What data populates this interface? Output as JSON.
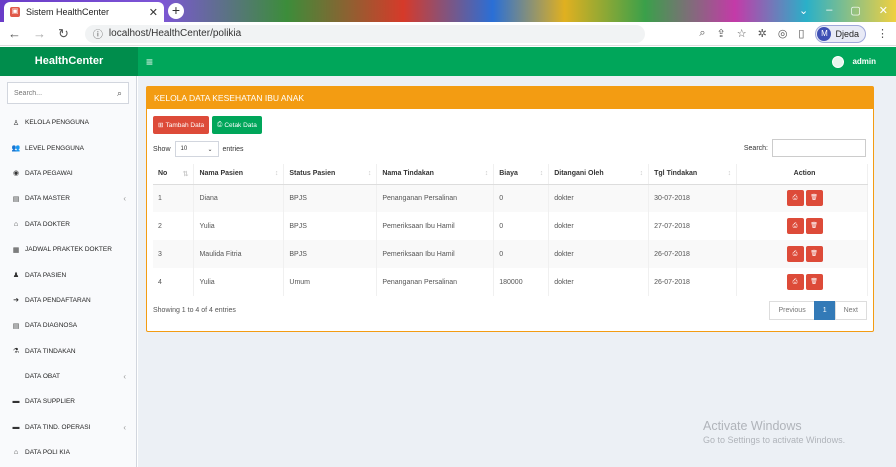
{
  "browser": {
    "tab_title": "Sistem HealthCenter",
    "url": "localhost/HealthCenter/polikia",
    "profile_initial": "M",
    "profile_name": "Djeda"
  },
  "app": {
    "logo": "HealthCenter",
    "user": "admin"
  },
  "sidebar": {
    "search_placeholder": "Search...",
    "items": [
      {
        "icon": "user-outline-icon",
        "label": "KELOLA PENGGUNA",
        "chevron": false
      },
      {
        "icon": "users-icon",
        "label": "LEVEL PENGGUNA",
        "chevron": false
      },
      {
        "icon": "user-circle-icon",
        "label": "DATA PEGAWAI",
        "chevron": false
      },
      {
        "icon": "id-card-icon",
        "label": "DATA MASTER",
        "chevron": true
      },
      {
        "icon": "graduation-cap-icon",
        "label": "DATA DOKTER",
        "chevron": false
      },
      {
        "icon": "calendar-icon",
        "label": "JADWAL PRAKTEK DOKTER",
        "chevron": false
      },
      {
        "icon": "user-icon",
        "label": "DATA PASIEN",
        "chevron": false
      },
      {
        "icon": "sign-in-icon",
        "label": "DATA PENDAFTARAN",
        "chevron": false
      },
      {
        "icon": "id-card-icon",
        "label": "DATA DIAGNOSA",
        "chevron": false
      },
      {
        "icon": "flask-icon",
        "label": "DATA TINDAKAN",
        "chevron": false
      },
      {
        "icon": "",
        "label": "DATA OBAT",
        "chevron": true
      },
      {
        "icon": "bed-icon",
        "label": "DATA SUPPLIER",
        "chevron": false
      },
      {
        "icon": "bed-icon",
        "label": "DATA TIND. OPERASI",
        "chevron": true
      },
      {
        "icon": "graduation-cap-icon",
        "label": "DATA POLI KIA",
        "chevron": false
      }
    ]
  },
  "main": {
    "box_title": "KELOLA DATA KESEHATAN IBU ANAK",
    "add_button": "Tambah Data",
    "print_button": "Cetak Data",
    "show_label": "Show",
    "entries_value": "10",
    "entries_label": "entries",
    "search_label": "Search:",
    "columns": [
      "No",
      "Nama Pasien",
      "Status Pasien",
      "Nama Tindakan",
      "Biaya",
      "Ditangani Oleh",
      "Tgl Tindakan",
      "Action"
    ],
    "rows": [
      {
        "no": "1",
        "nama": "Diana",
        "status": "BPJS",
        "tindakan": "Penanganan Persalinan",
        "biaya": "0",
        "oleh": "dokter",
        "tgl": "30-07-2018"
      },
      {
        "no": "2",
        "nama": "Yulia",
        "status": "BPJS",
        "tindakan": "Pemeriksaan Ibu Hamil",
        "biaya": "0",
        "oleh": "dokter",
        "tgl": "27-07-2018"
      },
      {
        "no": "3",
        "nama": "Maulida Fitria",
        "status": "BPJS",
        "tindakan": "Pemeriksaan Ibu Hamil",
        "biaya": "0",
        "oleh": "dokter",
        "tgl": "26-07-2018"
      },
      {
        "no": "4",
        "nama": "Yulia",
        "status": "Umum",
        "tindakan": "Penanganan Persalinan",
        "biaya": "180000",
        "oleh": "dokter",
        "tgl": "26-07-2018"
      }
    ],
    "info": "Showing 1 to 4 of 4 entries",
    "pager": {
      "previous": "Previous",
      "current": "1",
      "next": "Next"
    }
  },
  "watermark": {
    "line1": "Activate Windows",
    "line2": "Go to Settings to activate Windows."
  },
  "colors": {
    "header_green": "#00a65a",
    "logo_green": "#008d4c",
    "box_orange": "#f39c12",
    "button_red": "#dd4b39",
    "page_blue": "#337ab7"
  }
}
